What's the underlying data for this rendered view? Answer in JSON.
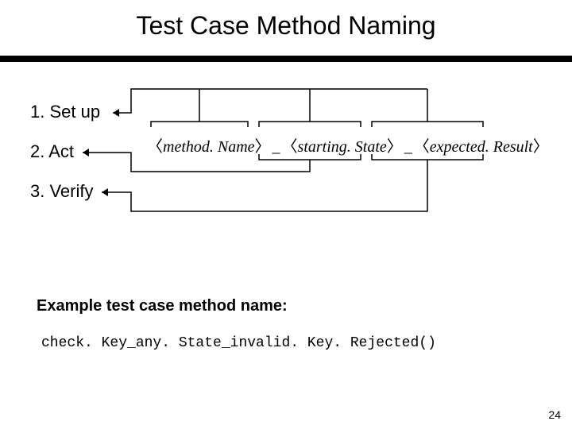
{
  "title": "Test Case Method Naming",
  "steps": {
    "s1": "1. Set up",
    "s2": "2. Act",
    "s3": "3. Verify"
  },
  "formula": {
    "open": "〈",
    "close": "〉",
    "p1": "method. Name",
    "p2": "starting. State",
    "p3": "expected. Result",
    "sep": "_"
  },
  "example_label": "Example test case method name:",
  "example_code": "check. Key_any. State_invalid. Key. Rejected()",
  "page_number": "24"
}
